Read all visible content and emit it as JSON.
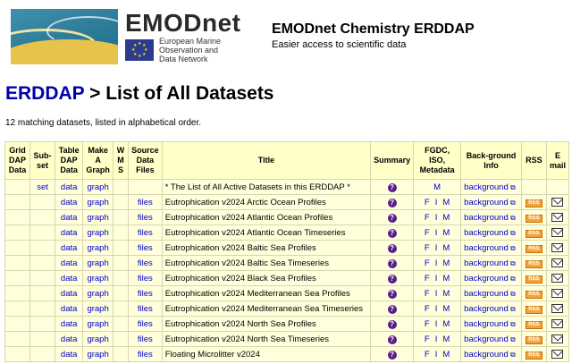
{
  "header": {
    "brand": "EMODnet",
    "eu_line1": "European Marine",
    "eu_line2": "Observation and",
    "eu_line3": "Data Network",
    "site_title": "EMODnet Chemistry ERDDAP",
    "site_subtitle": "Easier access to scientific data"
  },
  "page": {
    "erddap_link": "ERDDAP",
    "title_rest": " > List of All Datasets",
    "count_text": "12 matching datasets, listed in alphabetical order."
  },
  "columns": [
    "Grid DAP Data",
    "Sub-set",
    "Table DAP Data",
    "Make A Graph",
    "W M S",
    "Source Data Files",
    "Title",
    "Summary",
    "FGDC, ISO, Metadata",
    "Back-ground Info",
    "RSS",
    "E mail"
  ],
  "rows": [
    {
      "subset": "set",
      "tabledap": "data",
      "graph": "graph",
      "files": "",
      "title": "* The List of All Active Datasets in this ERDDAP *",
      "summary": "?",
      "f": "",
      "i": "",
      "m": "M",
      "bg": "background",
      "rss": "",
      "email": ""
    },
    {
      "subset": "",
      "tabledap": "data",
      "graph": "graph",
      "files": "files",
      "title": "Eutrophication v2024 Arctic Ocean Profiles",
      "summary": "?",
      "f": "F",
      "i": "I",
      "m": "M",
      "bg": "background",
      "rss": "RSS",
      "email": "email"
    },
    {
      "subset": "",
      "tabledap": "data",
      "graph": "graph",
      "files": "files",
      "title": "Eutrophication v2024 Atlantic Ocean Profiles",
      "summary": "?",
      "f": "F",
      "i": "I",
      "m": "M",
      "bg": "background",
      "rss": "RSS",
      "email": "email"
    },
    {
      "subset": "",
      "tabledap": "data",
      "graph": "graph",
      "files": "files",
      "title": "Eutrophication v2024 Atlantic Ocean Timeseries",
      "summary": "?",
      "f": "F",
      "i": "I",
      "m": "M",
      "bg": "background",
      "rss": "RSS",
      "email": "email"
    },
    {
      "subset": "",
      "tabledap": "data",
      "graph": "graph",
      "files": "files",
      "title": "Eutrophication v2024 Baltic Sea Profiles",
      "summary": "?",
      "f": "F",
      "i": "I",
      "m": "M",
      "bg": "background",
      "rss": "RSS",
      "email": "email"
    },
    {
      "subset": "",
      "tabledap": "data",
      "graph": "graph",
      "files": "files",
      "title": "Eutrophication v2024 Baltic Sea Timeseries",
      "summary": "?",
      "f": "F",
      "i": "I",
      "m": "M",
      "bg": "background",
      "rss": "RSS",
      "email": "email"
    },
    {
      "subset": "",
      "tabledap": "data",
      "graph": "graph",
      "files": "files",
      "title": "Eutrophication v2024 Black Sea Profiles",
      "summary": "?",
      "f": "F",
      "i": "I",
      "m": "M",
      "bg": "background",
      "rss": "RSS",
      "email": "email"
    },
    {
      "subset": "",
      "tabledap": "data",
      "graph": "graph",
      "files": "files",
      "title": "Eutrophication v2024 Mediterranean Sea Profiles",
      "summary": "?",
      "f": "F",
      "i": "I",
      "m": "M",
      "bg": "background",
      "rss": "RSS",
      "email": "email"
    },
    {
      "subset": "",
      "tabledap": "data",
      "graph": "graph",
      "files": "files",
      "title": "Eutrophication v2024 Mediterranean Sea Timeseries",
      "summary": "?",
      "f": "F",
      "i": "I",
      "m": "M",
      "bg": "background",
      "rss": "RSS",
      "email": "email"
    },
    {
      "subset": "",
      "tabledap": "data",
      "graph": "graph",
      "files": "files",
      "title": "Eutrophication v2024 North Sea Profiles",
      "summary": "?",
      "f": "F",
      "i": "I",
      "m": "M",
      "bg": "background",
      "rss": "RSS",
      "email": "email"
    },
    {
      "subset": "",
      "tabledap": "data",
      "graph": "graph",
      "files": "files",
      "title": "Eutrophication v2024 North Sea Timeseries",
      "summary": "?",
      "f": "F",
      "i": "I",
      "m": "M",
      "bg": "background",
      "rss": "RSS",
      "email": "email"
    },
    {
      "subset": "",
      "tabledap": "data",
      "graph": "graph",
      "files": "files",
      "title": "Floating Microlitter v2024",
      "summary": "?",
      "f": "F",
      "i": "I",
      "m": "M",
      "bg": "background",
      "rss": "RSS",
      "email": "email"
    }
  ],
  "colors": {
    "link": "#0000cc",
    "header_bg": "#ffffc8",
    "cell_bg": "#ffffdc",
    "rss": "#f5a23a",
    "summary_icon": "#5a1a88"
  },
  "icons": {
    "summary": "question-icon",
    "background": "external-link-icon",
    "rss": "rss-icon",
    "email": "envelope-icon"
  }
}
